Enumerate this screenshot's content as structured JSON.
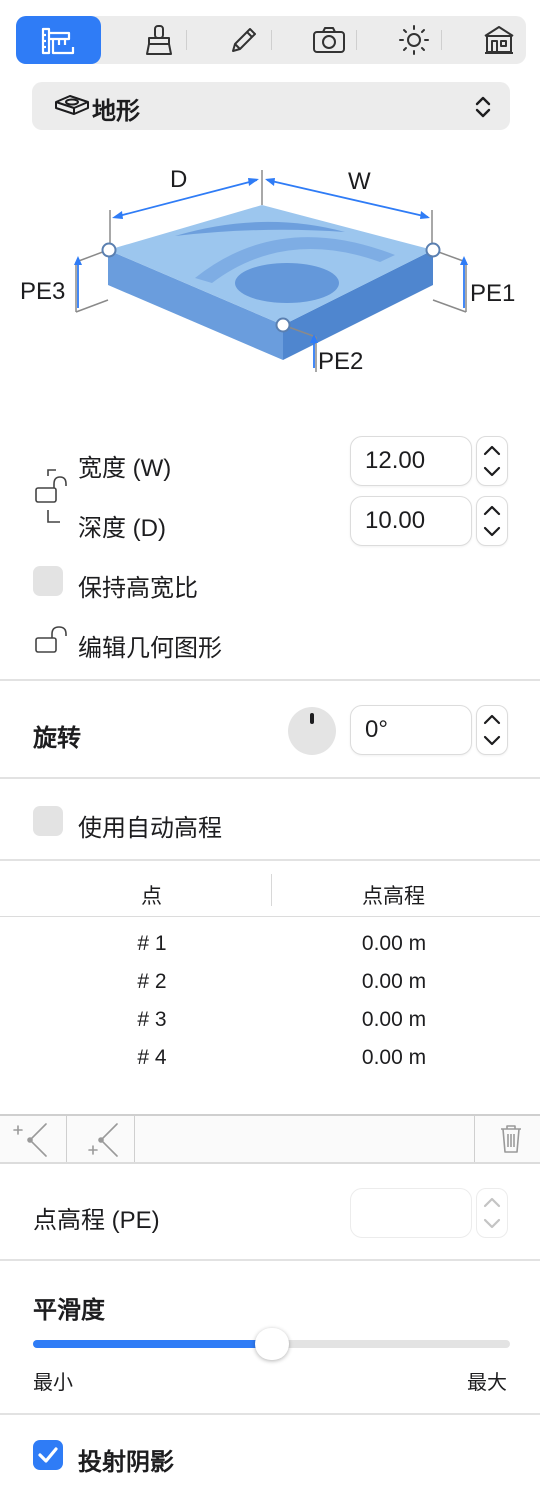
{
  "toolbar": {
    "tools": [
      {
        "icon": "ruler-triangle-icon",
        "active": true
      },
      {
        "icon": "brush-icon"
      },
      {
        "icon": "pencil-icon"
      },
      {
        "icon": "camera-icon"
      },
      {
        "icon": "sun-icon"
      },
      {
        "icon": "building-icon"
      }
    ]
  },
  "element_type": {
    "label": "地形",
    "icon": "terrain-icon"
  },
  "diagram": {
    "label_d": "D",
    "label_w": "W",
    "label_pe1": "PE1",
    "label_pe2": "PE2",
    "label_pe3": "PE3"
  },
  "size": {
    "width_label": "宽度 (W)",
    "width_value": "12.00",
    "depth_label": "深度 (D)",
    "depth_value": "10.00",
    "keep_ratio_label": "保持高宽比",
    "edit_geometry_label": "编辑几何图形"
  },
  "rotation": {
    "label": "旋转",
    "value": "0°"
  },
  "auto_elevation": {
    "label": "使用自动高程"
  },
  "points_table": {
    "columns": [
      "点",
      "点高程"
    ],
    "rows": [
      {
        "point": "# 1",
        "elevation": "0.00 m"
      },
      {
        "point": "# 2",
        "elevation": "0.00 m"
      },
      {
        "point": "# 3",
        "elevation": "0.00 m"
      },
      {
        "point": "# 4",
        "elevation": "0.00 m"
      }
    ]
  },
  "point_elevation": {
    "label": "点高程 (PE)",
    "value": ""
  },
  "smoothness": {
    "label": "平滑度",
    "min_label": "最小",
    "max_label": "最大",
    "value": 0.5
  },
  "cast_shadow": {
    "label": "投射阴影",
    "checked": true
  },
  "colors": {
    "accent": "#2f7cf6",
    "terrain_top": "#9cc6ee",
    "terrain_side": "#5a8fd6"
  }
}
